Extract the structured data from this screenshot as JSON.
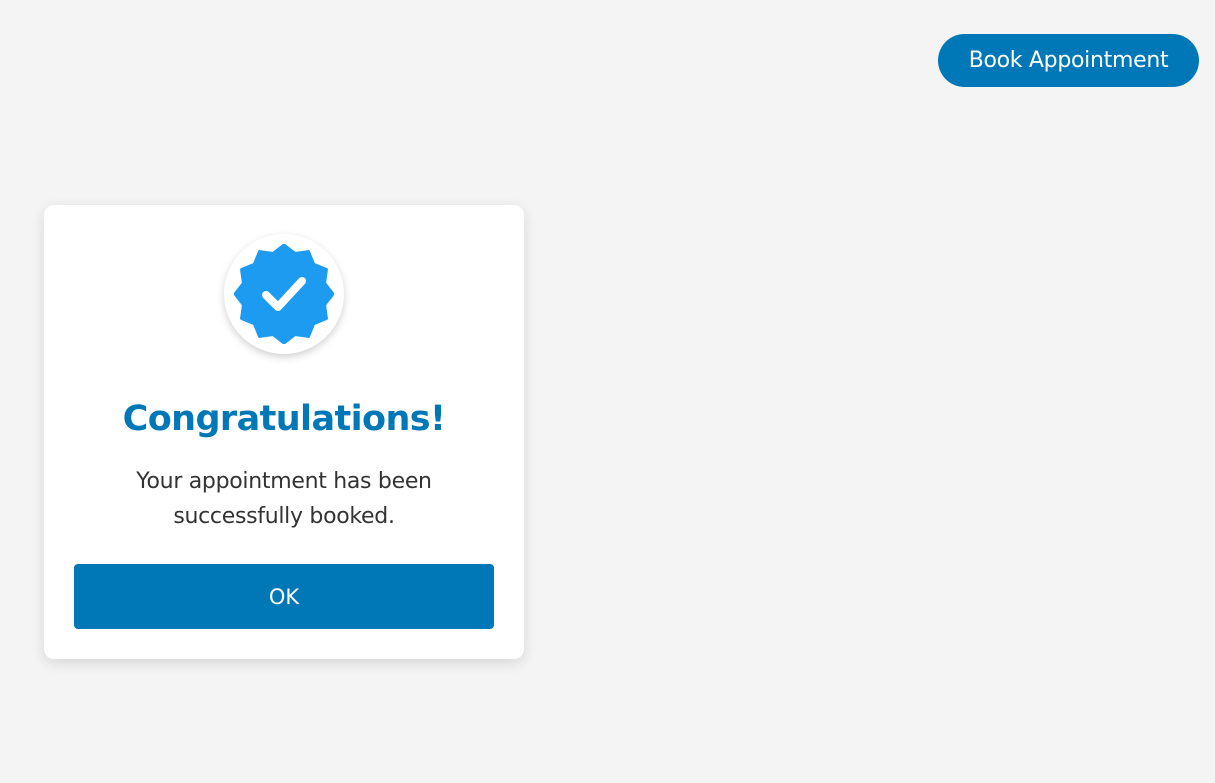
{
  "header": {
    "book_button_label": "Book Appointment"
  },
  "modal": {
    "icon": "verified-badge-check-icon",
    "title": "Congratulations!",
    "message": "Your appointment has been successfully booked.",
    "ok_label": "OK"
  },
  "colors": {
    "primary": "#0077b6",
    "badge": "#1d9bf0",
    "background": "#f4f4f4",
    "text": "#333333"
  }
}
